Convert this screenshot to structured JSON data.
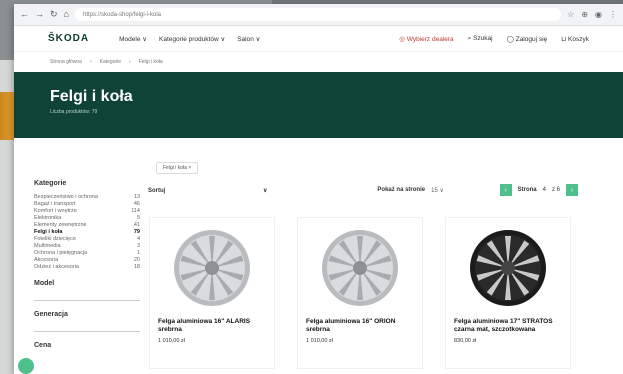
{
  "browser": {
    "url": "https://skoda-shop/felgi-i-kola",
    "nav_icons": [
      "back-icon",
      "forward-icon",
      "reload-icon",
      "home-icon"
    ]
  },
  "header": {
    "logo": "ŠKODA",
    "menu": [
      "Modele ∨",
      "Kategorie produktów ∨",
      "Salon ∨"
    ],
    "dealer": "Wybierz dealera",
    "search": "Szukaj",
    "account": "Zaloguj się",
    "cart": "Koszyk"
  },
  "breadcrumb": [
    "Strona główna",
    "Kategorie",
    "Felgi i koła"
  ],
  "hero": {
    "title": "Felgi i koła",
    "subtitle": "Liczba produktów: 79"
  },
  "filter_chip": "Felgi i koła ×",
  "sidebar": {
    "title": "Kategorie",
    "categories": [
      {
        "label": "Bezpieczeństwo i ochrona",
        "count": "13"
      },
      {
        "label": "Bagaż i transport",
        "count": "46"
      },
      {
        "label": "Komfort i wnętrze",
        "count": "114"
      },
      {
        "label": "Elektronika",
        "count": "5"
      },
      {
        "label": "Elementy zewnętrzne",
        "count": "41"
      },
      {
        "label": "Felgi i koła",
        "count": "79",
        "active": true
      },
      {
        "label": "Foteliki dziecięce",
        "count": "4"
      },
      {
        "label": "Multimedia",
        "count": "3"
      },
      {
        "label": "Ochrona i pielęgnacja",
        "count": "1"
      },
      {
        "label": "Akcesoria",
        "count": "20"
      },
      {
        "label": "Odzież i akcesoria",
        "count": "18"
      }
    ],
    "filters": [
      "Model",
      "Generacja",
      "Cena"
    ]
  },
  "toolbar": {
    "sort_label": "Sortuj",
    "per_page_label": "Pokaż na stronie",
    "per_page_value": "15 ∨",
    "page_label": "Strona",
    "page_current": "4",
    "page_total": "z 6"
  },
  "products": [
    {
      "name": "Felga aluminiowa 16\" ALARIS srebrna",
      "price": "1 010,00 zł",
      "color": "silver"
    },
    {
      "name": "Felga aluminiowa 16\" ORION srebrna",
      "price": "1 010,00 zł",
      "color": "silver"
    },
    {
      "name": "Felga aluminiowa 17\" STRATOS czarna mat, szczotkowana",
      "price": "830,00 zł",
      "color": "black"
    }
  ]
}
